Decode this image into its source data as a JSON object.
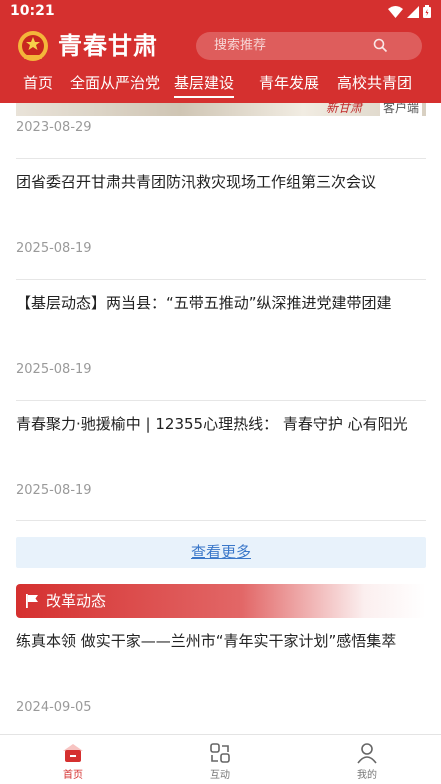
{
  "status_bar": {
    "time": "10:21"
  },
  "app": {
    "title": "青春甘肃",
    "search_placeholder": "搜索推荐"
  },
  "tabs": [
    {
      "label": "首页"
    },
    {
      "label": "全面从严治党"
    },
    {
      "label": "基层建设",
      "active": true
    },
    {
      "label": "青年发展"
    },
    {
      "label": "高校共青团"
    }
  ],
  "banner": {
    "client_tag": "客户端",
    "brush_text": "新甘肃"
  },
  "news": [
    {
      "title": "",
      "date": "2023-08-29"
    },
    {
      "title": "团省委召开甘肃共青团防汛救灾现场工作组第三次会议",
      "date": "2025-08-19"
    },
    {
      "title": "【基层动态】两当县：“五带五推动”纵深推进党建带团建",
      "date": "2025-08-19"
    },
    {
      "title": "青春聚力·驰援榆中 | 12355心理热线： 青春守护 心有阳光",
      "date": "2025-08-19"
    }
  ],
  "more_label": "查看更多",
  "section": {
    "title": "改革动态",
    "items": [
      {
        "title": "练真本领 做实干家——兰州市“青年实干家计划”感悟集萃",
        "date": "2024-09-05"
      }
    ]
  },
  "bottom_nav": [
    {
      "label": "首页",
      "icon": "home-icon",
      "active": true
    },
    {
      "label": "互动",
      "icon": "interaction-icon"
    },
    {
      "label": "我的",
      "icon": "profile-icon"
    }
  ],
  "colors": {
    "brand_red": "#d5302f",
    "more_bg": "#e8f2fb",
    "link_blue": "#3a77c9",
    "date_gray": "#9a9a9a"
  }
}
